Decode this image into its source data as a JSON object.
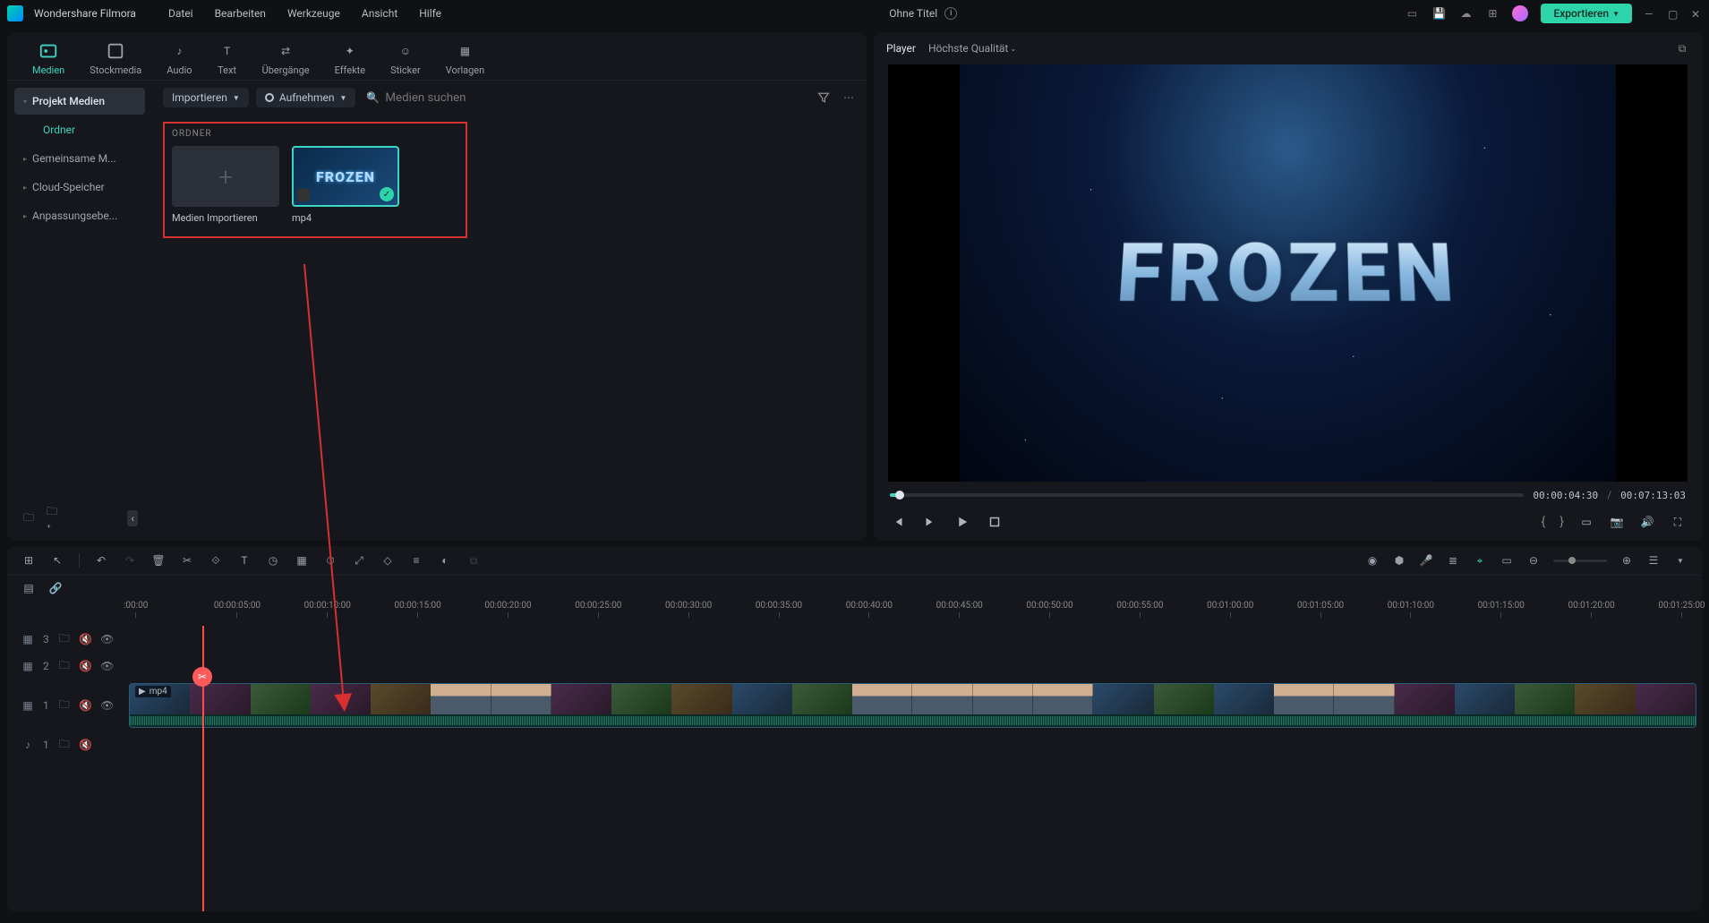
{
  "app": {
    "name": "Wondershare Filmora"
  },
  "menu": {
    "items": [
      "Datei",
      "Bearbeiten",
      "Werkzeuge",
      "Ansicht",
      "Hilfe"
    ]
  },
  "document": {
    "title": "Ohne Titel"
  },
  "export_button": "Exportieren",
  "tabs": [
    {
      "label": "Medien",
      "active": true
    },
    {
      "label": "Stockmedia"
    },
    {
      "label": "Audio"
    },
    {
      "label": "Text"
    },
    {
      "label": "Übergänge"
    },
    {
      "label": "Effekte"
    },
    {
      "label": "Sticker"
    },
    {
      "label": "Vorlagen"
    }
  ],
  "sidebar": {
    "items": [
      {
        "label": "Projekt Medien",
        "kind": "active-main"
      },
      {
        "label": "Ordner",
        "kind": "active-sub"
      },
      {
        "label": "Gemeinsame M..."
      },
      {
        "label": "Cloud-Speicher"
      },
      {
        "label": "Anpassungsebe..."
      }
    ]
  },
  "toolbar": {
    "import": "Importieren",
    "record": "Aufnehmen",
    "search_placeholder": "Medien suchen"
  },
  "media": {
    "folder_label": "ORDNER",
    "import_label": "Medien Importieren",
    "clip_label": "mp4"
  },
  "player": {
    "title": "Player",
    "quality": "Höchste Qualität",
    "current_time": "00:00:04:30",
    "total_time": "00:07:13:03",
    "preview_text": "FROZEN"
  },
  "timeline": {
    "ruler": [
      ":00:00",
      "00:00:05:00",
      "00:00:10:00",
      "00:00:15:00",
      "00:00:20:00",
      "00:00:25:00",
      "00:00:30:00",
      "00:00:35:00",
      "00:00:40:00",
      "00:00:45:00",
      "00:00:50:00",
      "00:00:55:00",
      "00:01:00:00",
      "00:01:05:00",
      "00:01:10:00",
      "00:01:15:00",
      "00:01:20:00",
      "00:01:25:00"
    ],
    "track_labels": {
      "v3": "3",
      "v2": "2",
      "v1": "1",
      "a1": "1"
    },
    "clip_label": "mp4"
  }
}
